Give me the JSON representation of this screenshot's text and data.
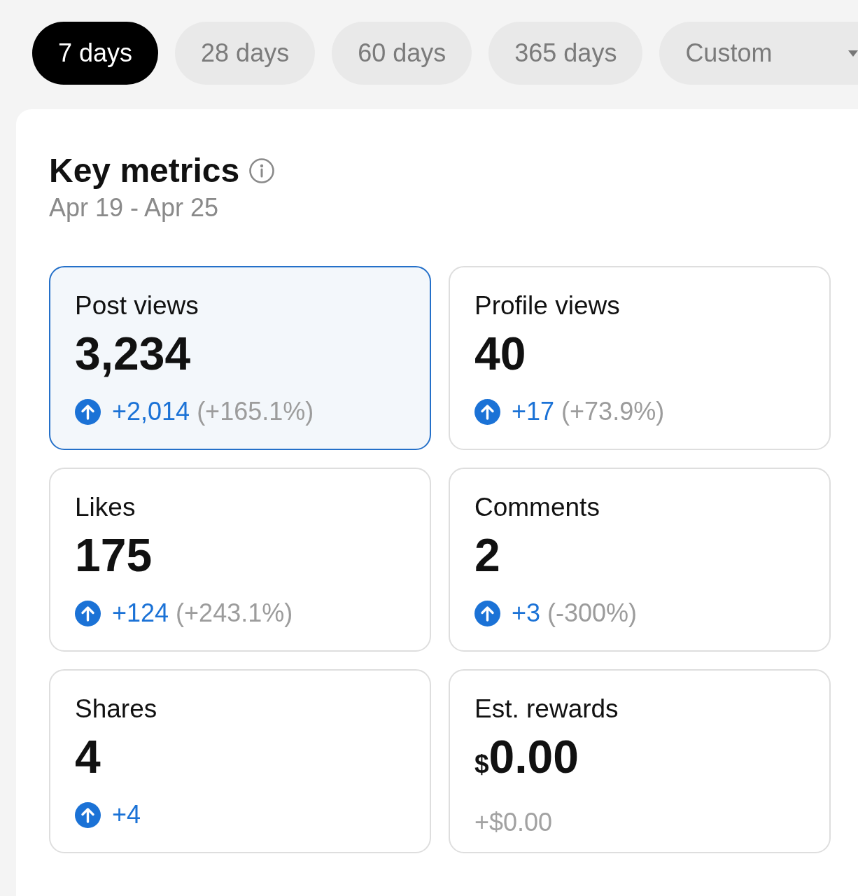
{
  "tabs": [
    {
      "label": "7 days",
      "kind": "option",
      "selected": true
    },
    {
      "label": "28 days",
      "kind": "option",
      "selected": false
    },
    {
      "label": "60 days",
      "kind": "option",
      "selected": false
    },
    {
      "label": "365 days",
      "kind": "option",
      "selected": false
    },
    {
      "label": "Custom",
      "kind": "dropdown",
      "selected": false
    }
  ],
  "key_metrics": {
    "title": "Key metrics",
    "date_range": "Apr 19 - Apr 25",
    "metrics": [
      {
        "label": "Post views",
        "value": "3,234",
        "change": "+2,014",
        "percent": "(+165.1%)",
        "increase": true,
        "selected": true
      },
      {
        "label": "Profile views",
        "value": "40",
        "change": "+17",
        "percent": "(+73.9%)",
        "increase": true,
        "selected": false
      },
      {
        "label": "Likes",
        "value": "175",
        "change": "+124",
        "percent": "(+243.1%)",
        "increase": true,
        "selected": false
      },
      {
        "label": "Comments",
        "value": "2",
        "change": "+3",
        "percent": "(-300%)",
        "increase": true,
        "selected": false
      },
      {
        "label": "Shares",
        "value": "4",
        "change": "+4",
        "increase": true,
        "selected": false
      },
      {
        "label": "Est. rewards",
        "currency": "$",
        "value": "0.00",
        "change": "+$0.00",
        "increase": false,
        "selected": false
      }
    ]
  }
}
